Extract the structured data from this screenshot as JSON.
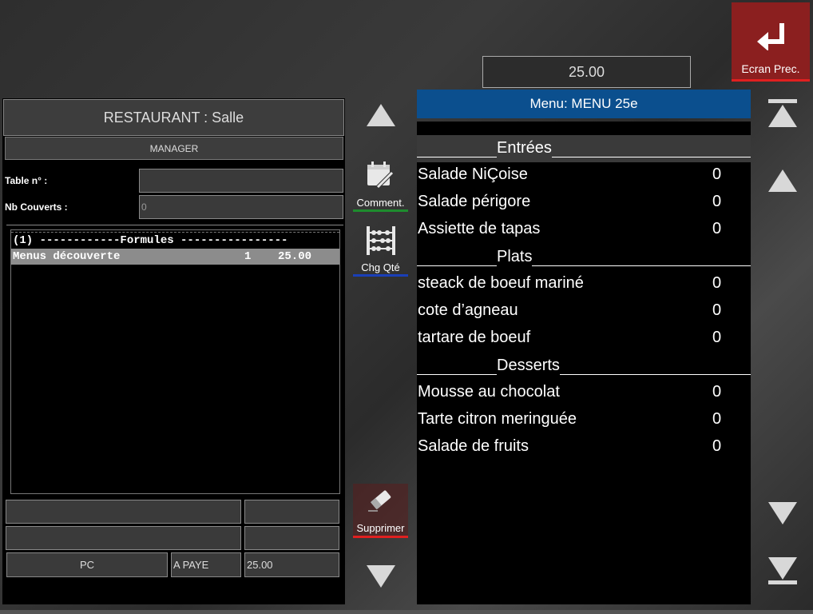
{
  "header": {
    "total_display": "25.00",
    "back_button_label": "Ecran Prec."
  },
  "order_panel": {
    "title": "RESTAURANT : Salle",
    "user": "MANAGER",
    "table_label": "Table n° :",
    "table_value": "",
    "covers_label": "Nb Couverts :",
    "covers_value": "0",
    "lines": [
      {
        "text": "(1) ------------Formules ----------------"
      },
      {
        "name": "Menus découverte",
        "qty": "1",
        "price": "25.00"
      }
    ],
    "footer": {
      "pc_label": "PC",
      "paid_label": "A PAYE",
      "amount": "25.00"
    }
  },
  "tools": {
    "comment_label": "Comment.",
    "change_qty_label": "Chg Qté",
    "delete_label": "Supprimer"
  },
  "menu": {
    "header": "Menu:   MENU 25e",
    "categories": [
      {
        "name": "Entrées",
        "items": [
          {
            "name": "Salade NiÇoise",
            "qty": "0"
          },
          {
            "name": "Salade périgore",
            "qty": "0"
          },
          {
            "name": "Assiette de tapas",
            "qty": "0"
          }
        ]
      },
      {
        "name": "Plats",
        "items": [
          {
            "name": "steack de boeuf mariné",
            "qty": "0"
          },
          {
            "name": "cote d’agneau",
            "qty": "0"
          },
          {
            "name": "tartare de boeuf",
            "qty": "0"
          }
        ]
      },
      {
        "name": "Desserts",
        "items": [
          {
            "name": "Mousse au chocolat",
            "qty": "0"
          },
          {
            "name": "Tarte citron meringuée",
            "qty": "0"
          },
          {
            "name": "Salade de fruits",
            "qty": "0"
          }
        ]
      }
    ]
  },
  "colors": {
    "menu_header_bg": "#0b4f8e",
    "back_button_bg": "#8b1f1f",
    "comment_underline": "#1e8c2e",
    "change_qty_underline": "#1a3fb8",
    "delete_underline": "#e02020"
  }
}
